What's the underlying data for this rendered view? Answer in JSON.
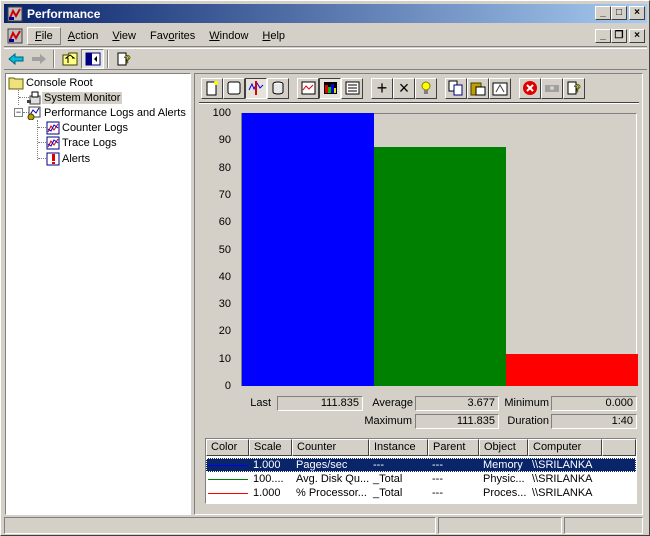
{
  "window": {
    "title": "Performance",
    "controls": {
      "minimize": "_",
      "maximize": "□",
      "close": "×"
    },
    "mdi_controls": {
      "minimize": "_",
      "restore": "❐",
      "close": "×"
    }
  },
  "menubar": {
    "items": [
      {
        "label": "File",
        "accel": "F"
      },
      {
        "label": "Action",
        "accel": "A"
      },
      {
        "label": "View",
        "accel": "V"
      },
      {
        "label": "Favorites",
        "accel": "o"
      },
      {
        "label": "Window",
        "accel": "W"
      },
      {
        "label": "Help",
        "accel": "H"
      }
    ]
  },
  "toolbar": {
    "buttons": [
      "back-icon",
      "forward-icon",
      "up-folder-icon",
      "show-hide-tree-icon",
      "help-icon"
    ]
  },
  "tree": {
    "items": [
      {
        "label": "Console Root",
        "icon": "folder-icon"
      },
      {
        "label": "System Monitor",
        "icon": "system-monitor-icon",
        "selected": true
      },
      {
        "label": "Performance Logs and Alerts",
        "icon": "perf-logs-icon",
        "expander": "−"
      },
      {
        "label": "Counter Logs",
        "icon": "counter-logs-icon"
      },
      {
        "label": "Trace Logs",
        "icon": "trace-logs-icon"
      },
      {
        "label": "Alerts",
        "icon": "alerts-icon"
      }
    ]
  },
  "monitor_toolbar": {
    "buttons": [
      "new-counter-set-icon",
      "clear-display-icon",
      "view-current-activity-icon",
      "view-log-data-icon",
      "view-graph-icon",
      "view-histogram-icon",
      "view-report-icon",
      "add-counter-icon",
      "delete-counter-icon",
      "highlight-icon",
      "copy-properties-icon",
      "paste-counter-list-icon",
      "properties-icon",
      "freeze-display-icon",
      "update-data-icon",
      "help-icon"
    ],
    "add_label": "+",
    "delete_label": "×"
  },
  "chart_data": {
    "type": "bar",
    "title": "",
    "xlabel": "",
    "ylabel": "",
    "ylim": [
      0,
      100
    ],
    "yticks": [
      "100",
      "90",
      "80",
      "70",
      "60",
      "50",
      "40",
      "30",
      "20",
      "10",
      "0"
    ],
    "categories": [
      "Pages/sec",
      "Avg. Disk Queue Length",
      "% Processor Time"
    ],
    "values": [
      111.835,
      87.5,
      11.7
    ],
    "colors": [
      "#0000ff",
      "#008000",
      "#ff0000"
    ],
    "grid": false
  },
  "stats": {
    "last_label": "Last",
    "last": "111.835",
    "average_label": "Average",
    "average": "3.677",
    "minimum_label": "Minimum",
    "minimum": "0.000",
    "maximum_label": "Maximum",
    "maximum": "111.835",
    "duration_label": "Duration",
    "duration": "1:40"
  },
  "legend": {
    "columns": [
      "Color",
      "Scale",
      "Counter",
      "Instance",
      "Parent",
      "Object",
      "Computer"
    ],
    "rows": [
      {
        "color": "#0000ff",
        "scale": "1.000",
        "counter": "Pages/sec",
        "instance": "---",
        "parent": "---",
        "object": "Memory",
        "computer": "\\\\SRILANKA",
        "selected": true
      },
      {
        "color": "#008000",
        "scale": "100....",
        "counter": "Avg. Disk Qu...",
        "instance": "_Total",
        "parent": "---",
        "object": "Physic...",
        "computer": "\\\\SRILANKA"
      },
      {
        "color": "#ff0000",
        "scale": "1.000",
        "counter": "% Processor...",
        "instance": "_Total",
        "parent": "---",
        "object": "Proces...",
        "computer": "\\\\SRILANKA"
      }
    ]
  },
  "statusbar": {
    "panes": [
      "",
      "",
      ""
    ]
  }
}
